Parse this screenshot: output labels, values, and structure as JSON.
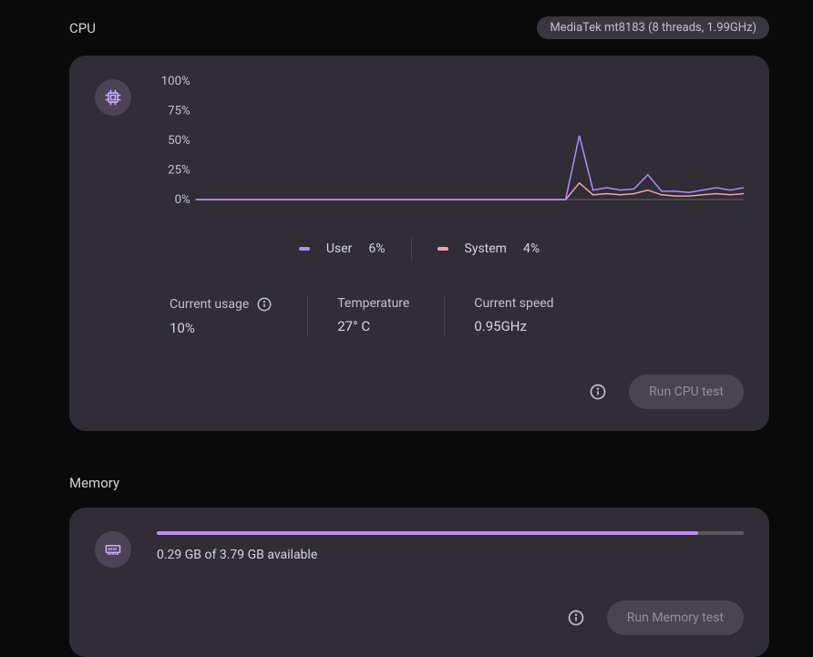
{
  "cpu": {
    "title": "CPU",
    "chip": "MediaTek mt8183 (8 threads, 1.99GHz)",
    "icon": "cpu-chip-icon",
    "legend": {
      "user_label": "User",
      "user_value": "6%",
      "system_label": "System",
      "system_value": "4%"
    },
    "stats": {
      "usage_label": "Current usage",
      "usage_value": "10%",
      "temp_label": "Temperature",
      "temp_value": "27° C",
      "speed_label": "Current speed",
      "speed_value": "0.95GHz"
    },
    "button": "Run CPU test"
  },
  "memory": {
    "title": "Memory",
    "icon": "memory-icon",
    "progress_text": "0.29 GB of 3.79 GB available",
    "progress_percent": 92.3,
    "button": "Run Memory test"
  },
  "colors": {
    "user": "#b18aff",
    "system": "#efa5a5",
    "accent": "#c58af9"
  },
  "chart_data": {
    "type": "line",
    "ylabel": "",
    "xlabel": "",
    "ylim": [
      0,
      100
    ],
    "y_ticks": [
      "100%",
      "75%",
      "50%",
      "25%",
      "0%"
    ],
    "x": [
      0,
      1,
      2,
      3,
      4,
      5,
      6,
      7,
      8,
      9,
      10,
      11,
      12,
      13,
      14,
      15,
      16,
      17,
      18,
      19,
      20,
      21,
      22,
      23,
      24,
      25,
      26,
      27,
      28,
      29,
      30,
      31,
      32,
      33,
      34,
      35,
      36,
      37,
      38,
      39,
      40
    ],
    "series": [
      {
        "name": "User",
        "values": [
          0,
          0,
          0,
          0,
          0,
          0,
          0,
          0,
          0,
          0,
          0,
          0,
          0,
          0,
          0,
          0,
          0,
          0,
          0,
          0,
          0,
          0,
          0,
          0,
          0,
          0,
          0,
          0,
          54,
          8,
          10,
          8,
          9,
          21,
          7,
          7,
          6,
          8,
          10,
          8,
          10
        ]
      },
      {
        "name": "System",
        "values": [
          0,
          0,
          0,
          0,
          0,
          0,
          0,
          0,
          0,
          0,
          0,
          0,
          0,
          0,
          0,
          0,
          0,
          0,
          0,
          0,
          0,
          0,
          0,
          0,
          0,
          0,
          0,
          0,
          14,
          4,
          5,
          4,
          5,
          8,
          4,
          3,
          3,
          4,
          5,
          4,
          5
        ]
      }
    ]
  }
}
